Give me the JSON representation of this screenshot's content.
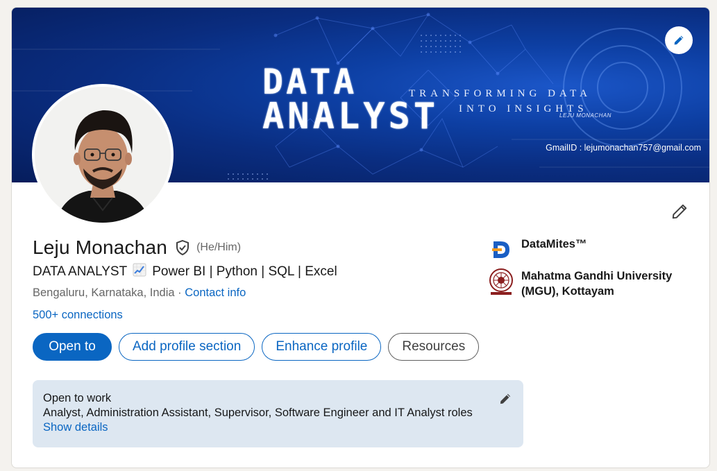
{
  "banner": {
    "title_line1": "DATA",
    "title_line2": "ANALYST",
    "tagline_line1": "TRANSFORMING DATA",
    "tagline_line2": "INTO INSIGHTS",
    "author": "LEJU MONACHAN",
    "email": "GmailID : lejumonachan757@gmail.com",
    "edit_icon": "pencil-icon"
  },
  "profile": {
    "name": "Leju Monachan",
    "pronouns": "(He/Him)",
    "headline_part1": "DATA ANALYST",
    "headline_emoji": "chart-increasing-icon",
    "headline_part2": "Power BI | Python | SQL | Excel",
    "location": "Bengaluru, Karnataka, India",
    "separator": " · ",
    "contact_info": "Contact info",
    "connections": "500+ connections"
  },
  "buttons": {
    "open_to": "Open to",
    "add_section": "Add profile section",
    "enhance": "Enhance profile",
    "resources": "Resources"
  },
  "open_to_work": {
    "title": "Open to work",
    "roles": "Analyst, Administration Assistant, Supervisor, Software Engineer and IT Analyst roles",
    "link": "Show details"
  },
  "side": {
    "company": "DataMites™",
    "education_line1": "Mahatma Gandhi University",
    "education_line2": "(MGU), Kottayam"
  },
  "colors": {
    "accent": "#0a66c2",
    "open_to_work_bg": "#dde7f1",
    "banner_dark": "#061d5c",
    "banner_light": "#1b56c8"
  }
}
